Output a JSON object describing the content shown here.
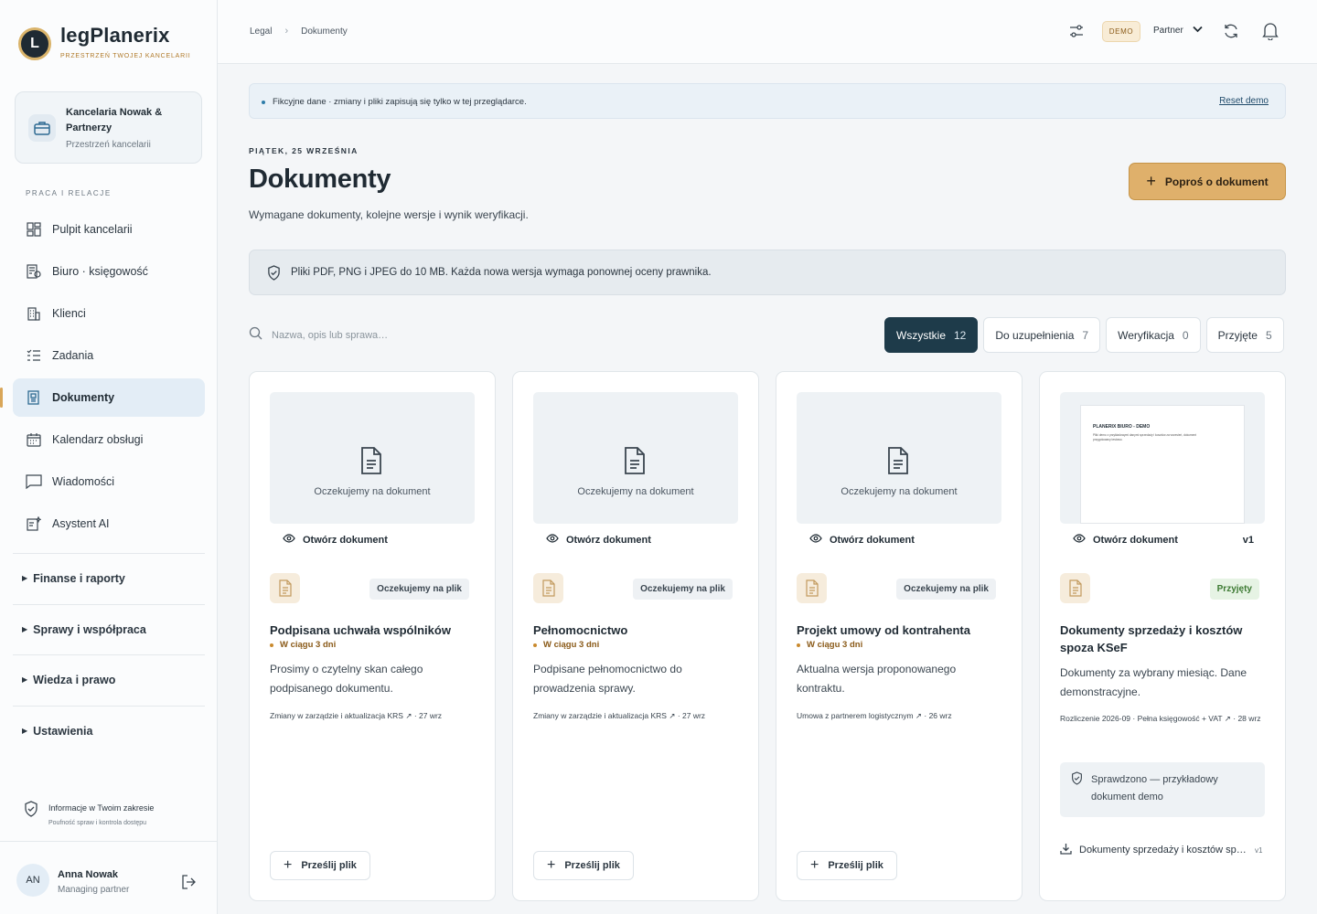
{
  "brand": {
    "name": "legPlanerix",
    "tagline": "PRZESTRZEŃ TWOJEJ KANCELARII",
    "logo_letter": "L"
  },
  "workspace": {
    "title": "Kancelaria Nowak & Partnerzy",
    "subtitle": "Przestrzeń kancelarii",
    "icon": "briefcase-icon"
  },
  "sidebar": {
    "section_label": "PRACA I RELACJE",
    "items": [
      {
        "label": "Pulpit kancelarii",
        "icon": "dashboard-icon"
      },
      {
        "label": "Biuro · księgowość",
        "icon": "accounting-icon"
      },
      {
        "label": "Klienci",
        "icon": "building-icon"
      },
      {
        "label": "Zadania",
        "icon": "tasks-icon"
      },
      {
        "label": "Dokumenty",
        "icon": "documents-icon",
        "active": true
      },
      {
        "label": "Kalendarz obsługi",
        "icon": "calendar-icon"
      },
      {
        "label": "Wiadomości",
        "icon": "message-icon"
      },
      {
        "label": "Asystent AI",
        "icon": "ai-icon"
      }
    ],
    "groups": [
      "Finanse i raporty",
      "Sprawy i współpraca",
      "Wiedza i prawo",
      "Ustawienia"
    ],
    "info": {
      "title": "Informacje w Twoim zakresie",
      "subtitle": "Poufność spraw i kontrola dostępu"
    }
  },
  "user": {
    "initials": "AN",
    "name": "Anna Nowak",
    "role": "Managing partner"
  },
  "topbar": {
    "breadcrumb": [
      "Legal",
      "Dokumenty"
    ],
    "demo_badge": "DEMO",
    "partner_label": "Partner"
  },
  "notice": {
    "text": "Fikcyjne dane · zmiany i pliki zapisują się tylko w tej przeglądarce.",
    "reset": "Reset demo"
  },
  "page": {
    "date": "PIĄTEK, 25 WRZEŚNIA",
    "title": "Dokumenty",
    "subtitle": "Wymagane dokumenty, kolejne wersje i wynik weryfikacji.",
    "request_button": "Poproś o dokument",
    "rules": "Pliki PDF, PNG i JPEG do 10 MB. Każda nowa wersja wymaga ponownej oceny prawnika.",
    "search_placeholder": "Nazwa, opis lub sprawa…"
  },
  "filters": [
    {
      "label": "Wszystkie",
      "count": "12",
      "active": true
    },
    {
      "label": "Do uzupełnienia",
      "count": "7"
    },
    {
      "label": "Weryfikacja",
      "count": "0"
    },
    {
      "label": "Przyjęte",
      "count": "5"
    }
  ],
  "cards": [
    {
      "preview_text": "Oczekujemy na dokument",
      "open_label": "Otwórz dokument",
      "status": "Oczekujemy na plik",
      "title": "Podpisana uchwała wspólników",
      "due": "W ciągu 3 dni",
      "description": "Prosimy o czytelny skan całego podpisanego dokumentu.",
      "meta": "Zmiany w zarządzie i aktualizacja KRS ↗ · 27 wrz",
      "upload": "Prześlij plik"
    },
    {
      "preview_text": "Oczekujemy na dokument",
      "open_label": "Otwórz dokument",
      "status": "Oczekujemy na plik",
      "title": "Pełnomocnictwo",
      "due": "W ciągu 3 dni",
      "description": "Podpisane pełnomocnictwo do prowadzenia sprawy.",
      "meta": "Zmiany w zarządzie i aktualizacja KRS ↗ · 27 wrz",
      "upload": "Prześlij plik"
    },
    {
      "preview_text": "Oczekujemy na dokument",
      "open_label": "Otwórz dokument",
      "status": "Oczekujemy na plik",
      "title": "Projekt umowy od kontrahenta",
      "due": "W ciągu 3 dni",
      "description": "Aktualna wersja proponowanego kontraktu.",
      "meta": "Umowa z partnerem logistycznym ↗ · 26 wrz",
      "upload": "Prześlij plik"
    },
    {
      "doc_page_title": "PLANERIX BIURO - DEMO",
      "doc_page_text": "Pliki demo z przykładowymi danymi sprzedaży i kosztów za wrzesień, dokument przygotowany testowo.",
      "open_label": "Otwórz dokument",
      "version": "v1",
      "status": "Przyjęty",
      "title": "Dokumenty sprzedaży i kosztów spoza KSeF",
      "description": "Dokumenty za wybrany miesiąc. Dane demonstracyjne.",
      "meta": "Rozliczenie 2026-09 · Pełna księgowość + VAT ↗ · 28 wrz",
      "checked": "Sprawdzono — przykładowy dokument demo",
      "download": "Dokumenty sprzedaży i kosztów spoza KSeF",
      "download_version": "v1"
    }
  ],
  "colors": {
    "accent": "#dfb06b",
    "active_filter": "#1e3b4a",
    "active_nav": "#e3edf6"
  }
}
